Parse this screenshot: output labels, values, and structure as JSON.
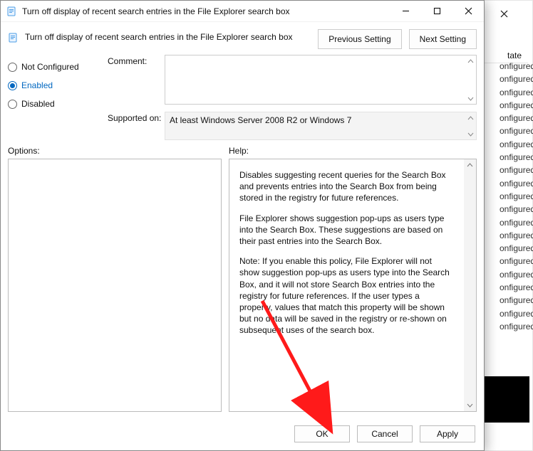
{
  "dialog": {
    "title": "Turn off display of recent search entries in the File Explorer search box",
    "subtitle": "Turn off display of recent search entries in the File Explorer search box",
    "buttons": {
      "previous": "Previous Setting",
      "next": "Next Setting"
    },
    "radios": {
      "not_configured": "Not Configured",
      "enabled": "Enabled",
      "disabled": "Disabled",
      "selected": "enabled"
    },
    "fields": {
      "comment_label": "Comment:",
      "comment_value": "",
      "supported_label": "Supported on:",
      "supported_value": "At least Windows Server 2008 R2 or Windows 7"
    },
    "labels": {
      "options": "Options:",
      "help": "Help:"
    },
    "help_paragraphs": [
      "Disables suggesting recent queries for the Search Box and prevents entries into the Search Box from being stored in the registry for future references.",
      "File Explorer shows suggestion pop-ups as users type into the Search Box.  These suggestions are based on their past entries into the Search Box.",
      "Note: If you enable this policy, File Explorer will not show suggestion pop-ups as users type into the Search Box, and it will not store Search Box entries into the registry for future references.  If the user types a property, values that match this property will be shown but no data will be saved in the registry or re-shown on subsequent uses of the search box."
    ],
    "actions": {
      "ok": "OK",
      "cancel": "Cancel",
      "apply": "Apply"
    }
  },
  "background": {
    "state_header": "tate",
    "rows": [
      "onfigured",
      "onfigured",
      "onfigured",
      "onfigured",
      "onfigured",
      "onfigured",
      "onfigured",
      "onfigured",
      "onfigured",
      "onfigured",
      "onfigured",
      "onfigured",
      "onfigured",
      "onfigured",
      "onfigured",
      "onfigured",
      "onfigured",
      "onfigured",
      "onfigured",
      "onfigured",
      "onfigured"
    ]
  }
}
